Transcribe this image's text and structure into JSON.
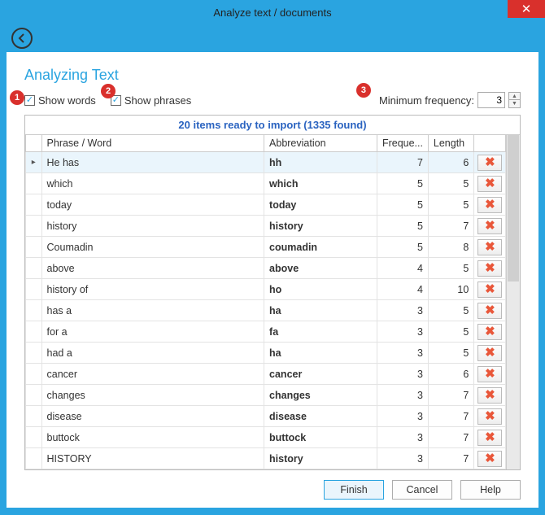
{
  "window": {
    "title": "Analyze text / documents"
  },
  "heading": "Analyzing Text",
  "options": {
    "show_words_label": "Show words",
    "show_words_checked": true,
    "show_phrases_label": "Show phrases",
    "show_phrases_checked": true,
    "min_freq_label": "Minimum frequency:",
    "min_freq_value": "3"
  },
  "badges": {
    "one": "1",
    "two": "2",
    "three": "3"
  },
  "summary": "20 items ready to import (1335 found)",
  "columns": {
    "phrase": "Phrase / Word",
    "abbr": "Abbreviation",
    "freq": "Freque...",
    "len": "Length"
  },
  "rows": [
    {
      "phrase": "He has",
      "abbr": "hh",
      "freq": 7,
      "len": 6,
      "selected": true
    },
    {
      "phrase": "which",
      "abbr": "which",
      "freq": 5,
      "len": 5
    },
    {
      "phrase": "today",
      "abbr": "today",
      "freq": 5,
      "len": 5
    },
    {
      "phrase": "history",
      "abbr": "history",
      "freq": 5,
      "len": 7
    },
    {
      "phrase": "Coumadin",
      "abbr": "coumadin",
      "freq": 5,
      "len": 8
    },
    {
      "phrase": "above",
      "abbr": "above",
      "freq": 4,
      "len": 5
    },
    {
      "phrase": "history of",
      "abbr": "ho",
      "freq": 4,
      "len": 10
    },
    {
      "phrase": "has a",
      "abbr": "ha",
      "freq": 3,
      "len": 5
    },
    {
      "phrase": "for a",
      "abbr": "fa",
      "freq": 3,
      "len": 5
    },
    {
      "phrase": "had a",
      "abbr": "ha",
      "freq": 3,
      "len": 5
    },
    {
      "phrase": "cancer",
      "abbr": "cancer",
      "freq": 3,
      "len": 6
    },
    {
      "phrase": "changes",
      "abbr": "changes",
      "freq": 3,
      "len": 7
    },
    {
      "phrase": "disease",
      "abbr": "disease",
      "freq": 3,
      "len": 7
    },
    {
      "phrase": "buttock",
      "abbr": "buttock",
      "freq": 3,
      "len": 7
    },
    {
      "phrase": "HISTORY",
      "abbr": "history",
      "freq": 3,
      "len": 7
    }
  ],
  "buttons": {
    "finish": "Finish",
    "cancel": "Cancel",
    "help": "Help"
  }
}
